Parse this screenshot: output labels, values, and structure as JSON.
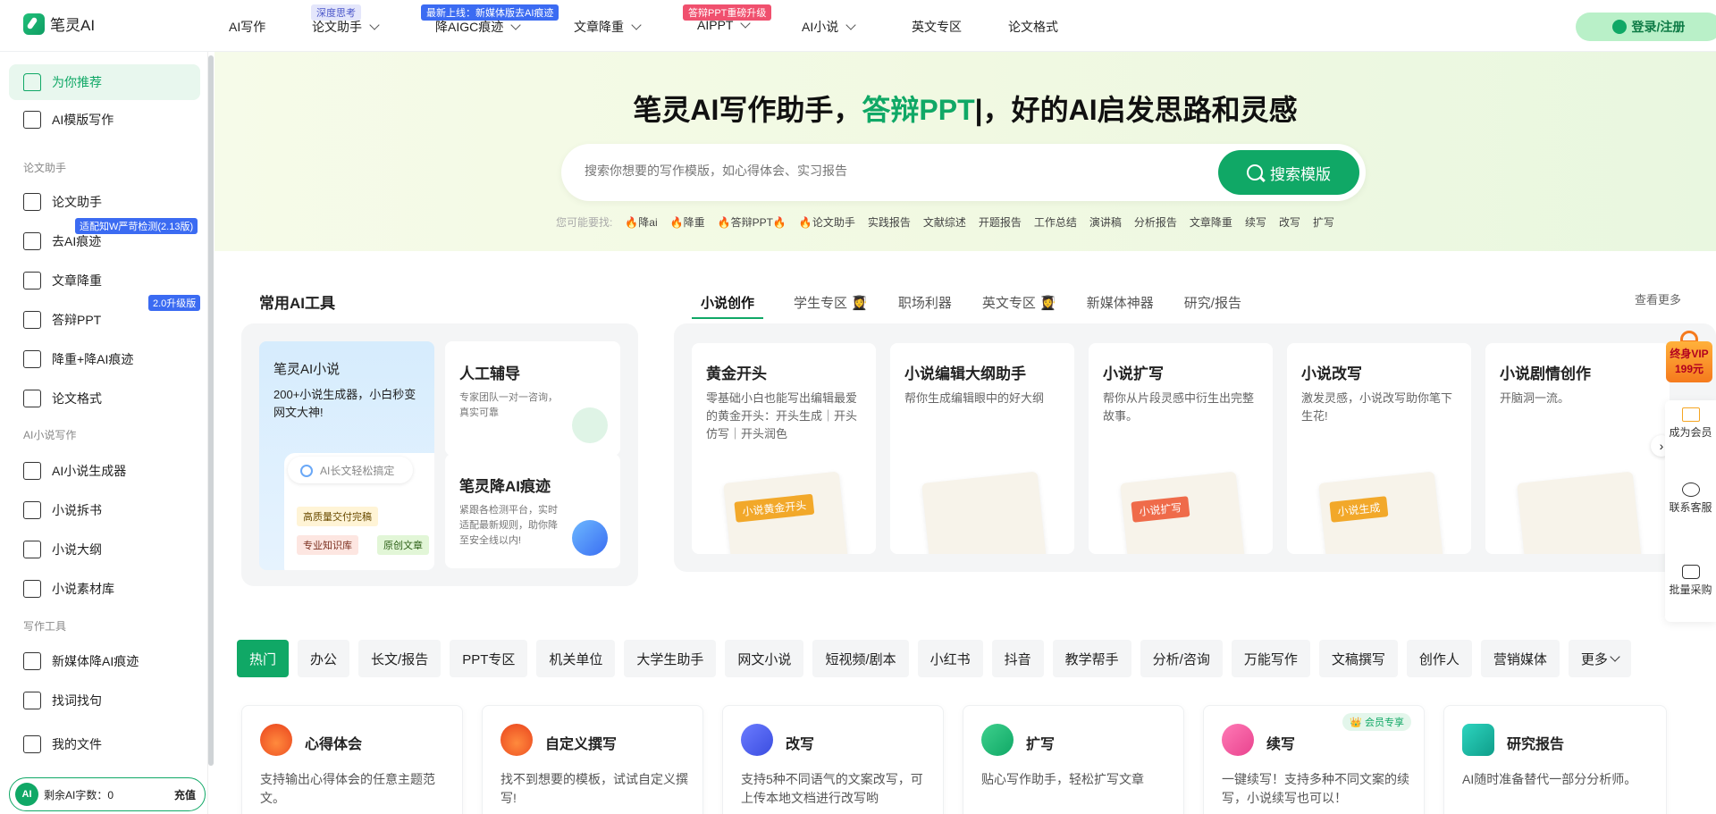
{
  "brand": {
    "name": "笔灵AI"
  },
  "nav": {
    "items": [
      {
        "label": "AI写作",
        "badge": ""
      },
      {
        "label": "论文助手",
        "badge": "深度思考"
      },
      {
        "label": "降AIGC痕迹",
        "badge": "最新上线：新媒体版去AI痕迹"
      },
      {
        "label": "文章降重",
        "badge": ""
      },
      {
        "label": "AIPPT",
        "badge": "答辩PPT重磅升级"
      },
      {
        "label": "AI小说",
        "badge": ""
      },
      {
        "label": "英文专区",
        "badge": ""
      },
      {
        "label": "论文格式",
        "badge": ""
      }
    ],
    "login": "登录/注册"
  },
  "sidebar": {
    "items": [
      {
        "label": "为你推荐"
      },
      {
        "label": "AI模版写作"
      },
      {
        "label": "论文助手"
      },
      {
        "label": "去AI痕迹"
      },
      {
        "label": "文章降重"
      },
      {
        "label": "答辩PPT"
      },
      {
        "label": "降重+降AI痕迹"
      },
      {
        "label": "论文格式"
      },
      {
        "label": "AI小说生成器"
      },
      {
        "label": "小说拆书"
      },
      {
        "label": "小说大纲"
      },
      {
        "label": "小说素材库"
      },
      {
        "label": "新媒体降AI痕迹"
      },
      {
        "label": "找词找句"
      },
      {
        "label": "我的文件"
      }
    ],
    "sections": [
      "论文助手",
      "AI小说写作",
      "写作工具"
    ],
    "badges": [
      "适配知W严苛检测(2.13版)",
      "2.0升级版"
    ],
    "remain_label": "剩余AI字数：0",
    "charge": "充值",
    "ai_logo": "AI"
  },
  "hero": {
    "title_a": "笔灵AI写作助手，",
    "title_hl": "答辩PPT",
    "title_b": "|，好的AI启发思路和灵感",
    "search_placeholder": "搜索你想要的写作模版，如心得体会、实习报告",
    "search_btn": "搜索模版",
    "suggest_label": "您可能要找:",
    "suggests": [
      "降ai",
      "降重",
      "答辩PPT",
      "论文助手",
      "实践报告",
      "文献综述",
      "开题报告",
      "工作总结",
      "演讲稿",
      "分析报告",
      "文章降重",
      "续写",
      "改写",
      "扩写"
    ]
  },
  "tools": {
    "title": "常用AI工具",
    "big": {
      "title": "笔灵AI小说",
      "desc": "200+小说生成器，小白秒变网文大神!",
      "pill": "AI长文轻松搞定",
      "tags": [
        "高质量交付完稿",
        "专业知识库",
        "原创文章"
      ]
    },
    "cards": [
      {
        "title": "人工辅导",
        "desc": "专家团队一对一咨询，真实可靠"
      },
      {
        "title": "笔灵降AI痕迹",
        "desc": "紧跟各检测平台，实时适配最新规则，助你降至安全线以内!"
      }
    ]
  },
  "tabs": {
    "items": [
      "小说创作",
      "学生专区",
      "职场利器",
      "英文专区",
      "新媒体神器",
      "研究/报告"
    ],
    "more": "查看更多"
  },
  "novel_cards": [
    {
      "title": "黄金开头",
      "desc": "零基础小白也能写出编辑最爱的黄金开头：开头生成｜开头仿写｜开头润色",
      "ribbon": "小说黄金开头"
    },
    {
      "title": "小说编辑大纲助手",
      "desc": "帮你生成编辑眼中的好大纲",
      "ribbon": ""
    },
    {
      "title": "小说扩写",
      "desc": "帮你从片段灵感中衍生出完整故事。",
      "ribbon": "小说扩写"
    },
    {
      "title": "小说改写",
      "desc": "激发灵感，小说改写助你笔下生花!",
      "ribbon": "小说生成"
    },
    {
      "title": "小说剧情创作",
      "desc": "开脑洞一流。",
      "ribbon": ""
    }
  ],
  "float": {
    "vip": [
      "终身VIP",
      "199元"
    ],
    "items": [
      "成为会员",
      "联系客服",
      "批量采购"
    ]
  },
  "chips": [
    "热门",
    "办公",
    "长文/报告",
    "PPT专区",
    "机关单位",
    "大学生助手",
    "网文小说",
    "短视频/剧本",
    "小红书",
    "抖音",
    "教学帮手",
    "分析/咨询",
    "万能写作",
    "文稿撰写",
    "创作人",
    "营销媒体",
    "更多"
  ],
  "bottom_cards": [
    {
      "title": "心得体会",
      "desc": "支持输出心得体会的任意主题范文。",
      "tag": ""
    },
    {
      "title": "自定义撰写",
      "desc": "找不到想要的模板，试试自定义撰写!",
      "tag": ""
    },
    {
      "title": "改写",
      "desc": "支持5种不同语气的文案改写，可上传本地文档进行改写哟",
      "tag": ""
    },
    {
      "title": "扩写",
      "desc": "贴心写作助手，轻松扩写文章",
      "tag": ""
    },
    {
      "title": "续写",
      "desc": "一键续写！支持多种不同文案的续写，小说续写也可以！",
      "tag": "会员专享"
    },
    {
      "title": "研究报告",
      "desc": "AI随时准备替代一部分分析师。",
      "tag": ""
    }
  ],
  "colors": {
    "accent": "#10a866",
    "badge_blue": "#3b6bf2",
    "badge_red": "#f0506e",
    "badge_lilac": "#e4e6fb"
  }
}
